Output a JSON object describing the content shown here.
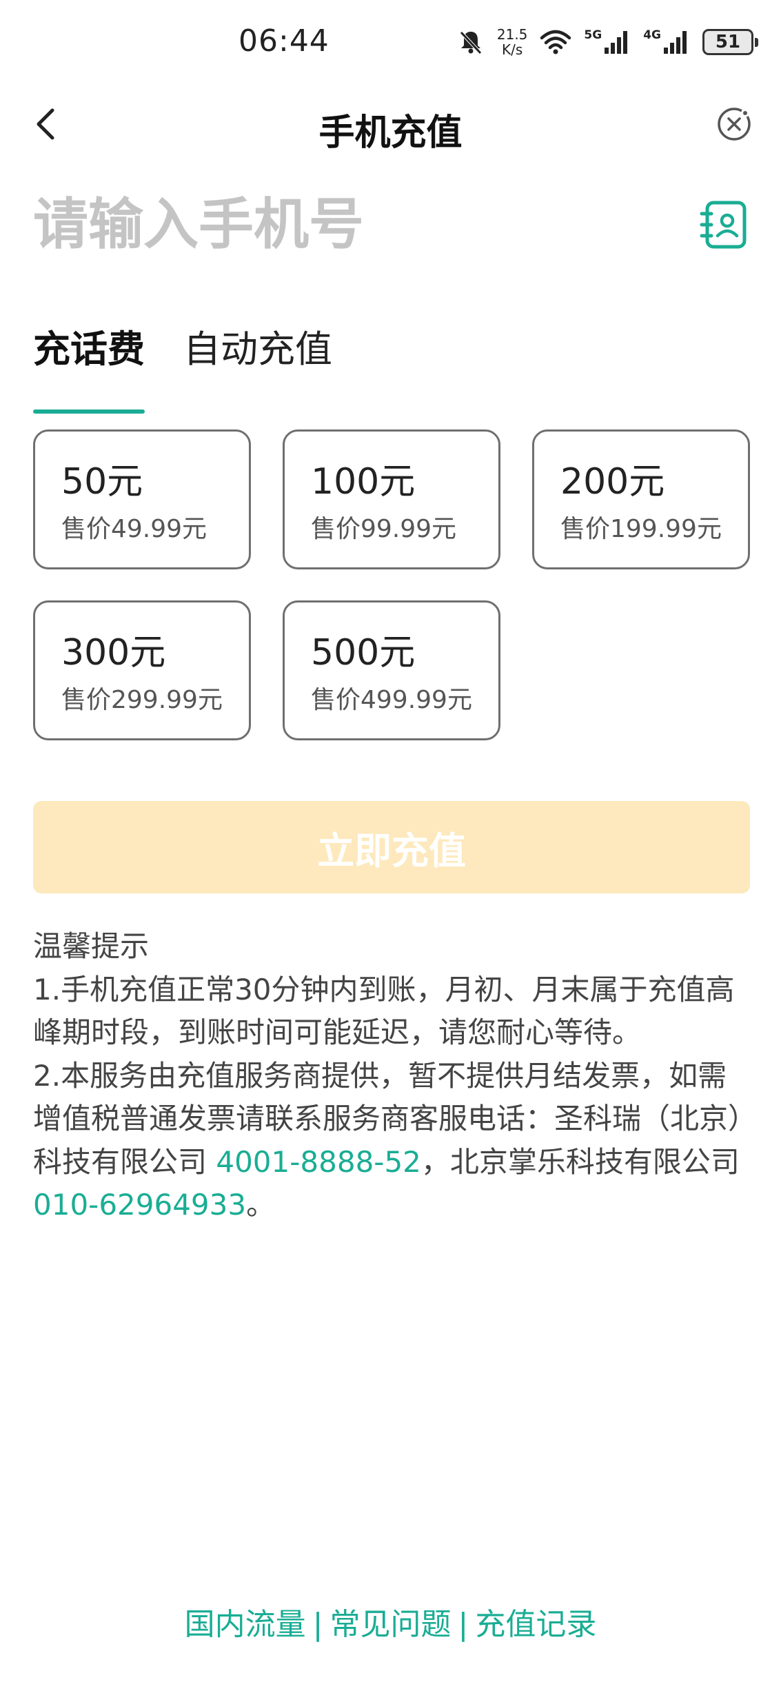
{
  "status_bar": {
    "time": "06:44",
    "speed_value": "21.5",
    "speed_unit": "K/s",
    "net_5g": "5G",
    "net_4g": "4G",
    "battery": "51",
    "icons": [
      "bell-muted-icon",
      "wifi-icon",
      "signal-5g-icon",
      "signal-4g-icon",
      "battery-icon"
    ]
  },
  "nav": {
    "title": "手机充值",
    "back_icon": "chevron-left-icon",
    "close_icon": "close-circle-icon"
  },
  "phone": {
    "placeholder": "请输入手机号",
    "value": "",
    "contacts_icon": "contacts-book-icon"
  },
  "tabs": [
    {
      "label": "充话费",
      "active": true
    },
    {
      "label": "自动充值",
      "active": false
    }
  ],
  "amounts": [
    {
      "amount": "50元",
      "price": "售价49.99元"
    },
    {
      "amount": "100元",
      "price": "售价99.99元"
    },
    {
      "amount": "200元",
      "price": "售价199.99元"
    },
    {
      "amount": "300元",
      "price": "售价299.99元"
    },
    {
      "amount": "500元",
      "price": "售价499.99元"
    }
  ],
  "recharge_button": {
    "label": "立即充值"
  },
  "tips": {
    "title": "温馨提示",
    "line1": "1.手机充值正常30分钟内到账，月初、月末属于充值高峰期时段，到账时间可能延迟，请您耐心等待。",
    "line2_prefix": "2.本服务由充值服务商提供，暂不提供月结发票，如需增值税普通发票请联系服务商客服电话：圣科瑞（北京）科技有限公司 ",
    "phone1": "4001-8888-52",
    "line2_middle": "，北京掌乐科技有限公司 ",
    "phone2": "010-62964933",
    "line2_suffix": "。"
  },
  "footer": {
    "links": [
      "国内流量",
      "常见问题",
      "充值记录"
    ],
    "separator": "|"
  },
  "colors": {
    "accent": "#1aad94",
    "button_disabled": "#fde9bd",
    "card_border": "#6f6f6f"
  }
}
